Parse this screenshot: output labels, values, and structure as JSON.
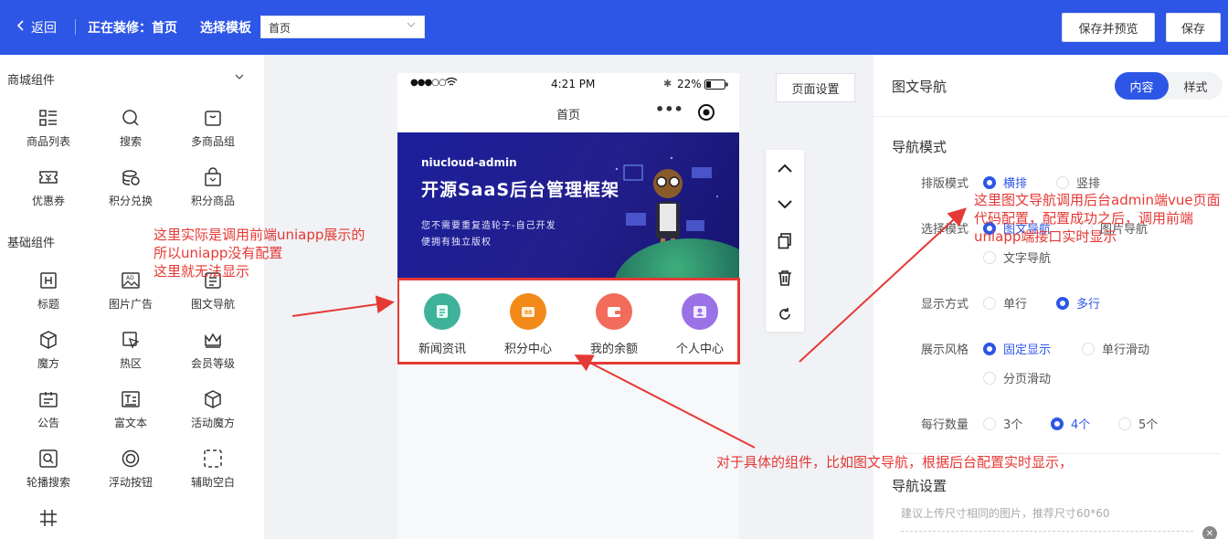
{
  "topbar": {
    "back_label": "返回",
    "editing_label": "正在装修：首页",
    "template_label": "选择模板",
    "template_value": "首页",
    "save_preview_label": "保存并预览",
    "save_label": "保存"
  },
  "left": {
    "groups": [
      {
        "title": "商城组件",
        "items": [
          "商品列表",
          "搜索",
          "多商品组",
          "优惠券",
          "积分兑换",
          "积分商品"
        ]
      },
      {
        "title": "基础组件",
        "items": [
          "标题",
          "图片广告",
          "图文导航",
          "魔方",
          "热区",
          "会员等级",
          "公告",
          "富文本",
          "活动魔方",
          "轮播搜索",
          "浮动按钮",
          "辅助空白"
        ]
      }
    ]
  },
  "phone": {
    "status_signal": "●●●○○",
    "status_time": "4:21 PM",
    "status_battery": "22%",
    "page_title": "首页",
    "banner": {
      "brand": "niucloud-admin",
      "headline": "开源SaaS后台管理框架",
      "sub1": "您不需要重复造轮子-自己开发",
      "sub2": "便拥有独立版权"
    },
    "nav_items": [
      {
        "label": "新闻资讯",
        "color": "#3fb39a"
      },
      {
        "label": "积分中心",
        "color": "#f28a1a"
      },
      {
        "label": "我的余额",
        "color": "#f26b5b"
      },
      {
        "label": "个人中心",
        "color": "#9b72e6"
      }
    ]
  },
  "canvas": {
    "page_setting_label": "页面设置"
  },
  "right": {
    "header": "图文导航",
    "tabs": [
      "内容",
      "样式"
    ],
    "nav_mode_section": "导航模式",
    "layout_label": "排版模式",
    "layout_options": [
      "横排",
      "竖排"
    ],
    "select_mode_label": "选择模式",
    "select_options": [
      "图文导航",
      "图片导航",
      "文字导航"
    ],
    "display_label": "显示方式",
    "display_options": [
      "单行",
      "多行"
    ],
    "style_label": "展示风格",
    "style_options": [
      "固定显示",
      "单行滑动",
      "分页滑动"
    ],
    "per_row_label": "每行数量",
    "per_row_options": [
      "3个",
      "4个",
      "5个"
    ],
    "nav_settings_section": "导航设置",
    "upload_hint": "建议上传尺寸相同的图片，推荐尺寸60*60",
    "accent": "#2d56e6"
  },
  "annotations": {
    "left_note": [
      "这里实际是调用前端uniapp展示的",
      "所以uniapp没有配置",
      "这里就无法显示"
    ],
    "right_note": [
      "这里图文导航调用后台admin端vue页面",
      "代码配置，配置成功之后，调用前端",
      "uniapp端接口实时显示"
    ],
    "bottom_note": "对于具体的组件，比如图文导航，根据后台配置实时显示，",
    "color": "#e53935"
  }
}
